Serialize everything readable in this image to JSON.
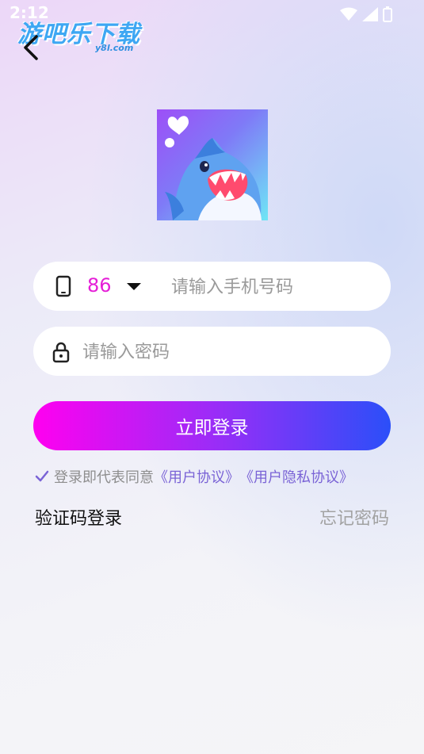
{
  "status_bar": {
    "time": "2:12"
  },
  "watermark": {
    "title": "游吧乐下载",
    "domain": "y8l.com"
  },
  "login_form": {
    "country_code": "86",
    "phone_placeholder": "请输入手机号码",
    "password_placeholder": "请输入密码",
    "submit_label": "立即登录"
  },
  "agreement": {
    "prefix": "登录即代表同意",
    "user_agreement": "《用户协议》",
    "privacy_agreement": "《用户隐私协议》"
  },
  "footer_links": {
    "sms_login": "验证码登录",
    "forgot_password": "忘记密码"
  },
  "colors": {
    "accent_pink": "#e51ed7",
    "gradient_start": "#ff00f0",
    "gradient_end": "#2b4ff9",
    "link_purple": "#7a63d6"
  }
}
